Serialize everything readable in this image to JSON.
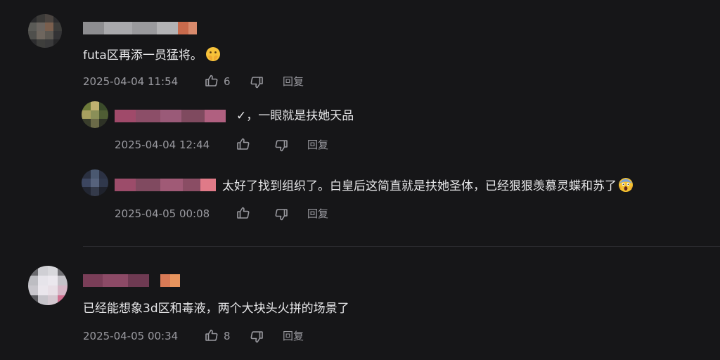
{
  "comments": [
    {
      "text": "futa区再添一员猛将。",
      "time": "2025-04-04 11:54",
      "likes": "6",
      "reply_label": "回复"
    },
    {
      "text": "✓，一眼就是扶她天品",
      "time": "2025-04-04 12:44",
      "reply_label": "回复"
    },
    {
      "text": "太好了找到组织了。白皇后这简直就是扶她圣体，已经狠狠羡慕灵蝶和苏了",
      "time": "2025-04-05 00:08",
      "reply_label": "回复"
    },
    {
      "text": "已经能想象3d区和毒液，两个大块头火拼的场景了",
      "time": "2025-04-05 00:34",
      "likes": "8",
      "reply_label": "回复"
    }
  ],
  "colors": {
    "background": "#161618",
    "text": "#e6e6e8",
    "meta": "#9a9aa0",
    "divider": "#2b2b2f"
  },
  "icons": [
    "like-icon",
    "dislike-icon",
    "emoji-hands-over-mouth-icon",
    "emoji-screaming-face-icon"
  ]
}
